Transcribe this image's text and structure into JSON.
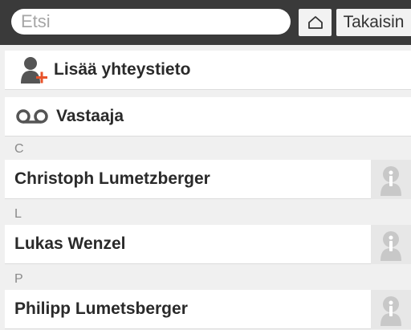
{
  "header": {
    "search_placeholder": "Etsi",
    "home_icon": "home-icon",
    "back_label": "Takaisin"
  },
  "actions": {
    "add_contact_label": "Lisää yhteystieto",
    "add_contact_icon": "add-contact-icon",
    "voicemail_label": "Vastaaja",
    "voicemail_icon": "voicemail-icon"
  },
  "sections": [
    {
      "letter": "C",
      "contacts": [
        {
          "name": "Christoph Lumetzberger"
        }
      ]
    },
    {
      "letter": "L",
      "contacts": [
        {
          "name": "Lukas Wenzel"
        }
      ]
    },
    {
      "letter": "P",
      "contacts": [
        {
          "name": "Philipp Lumetsberger"
        }
      ]
    }
  ],
  "colors": {
    "header_bg": "#3a3a3a",
    "add_icon_accent": "#e8532a",
    "icon_gray": "#555555",
    "info_icon": "#c8c8c8"
  }
}
